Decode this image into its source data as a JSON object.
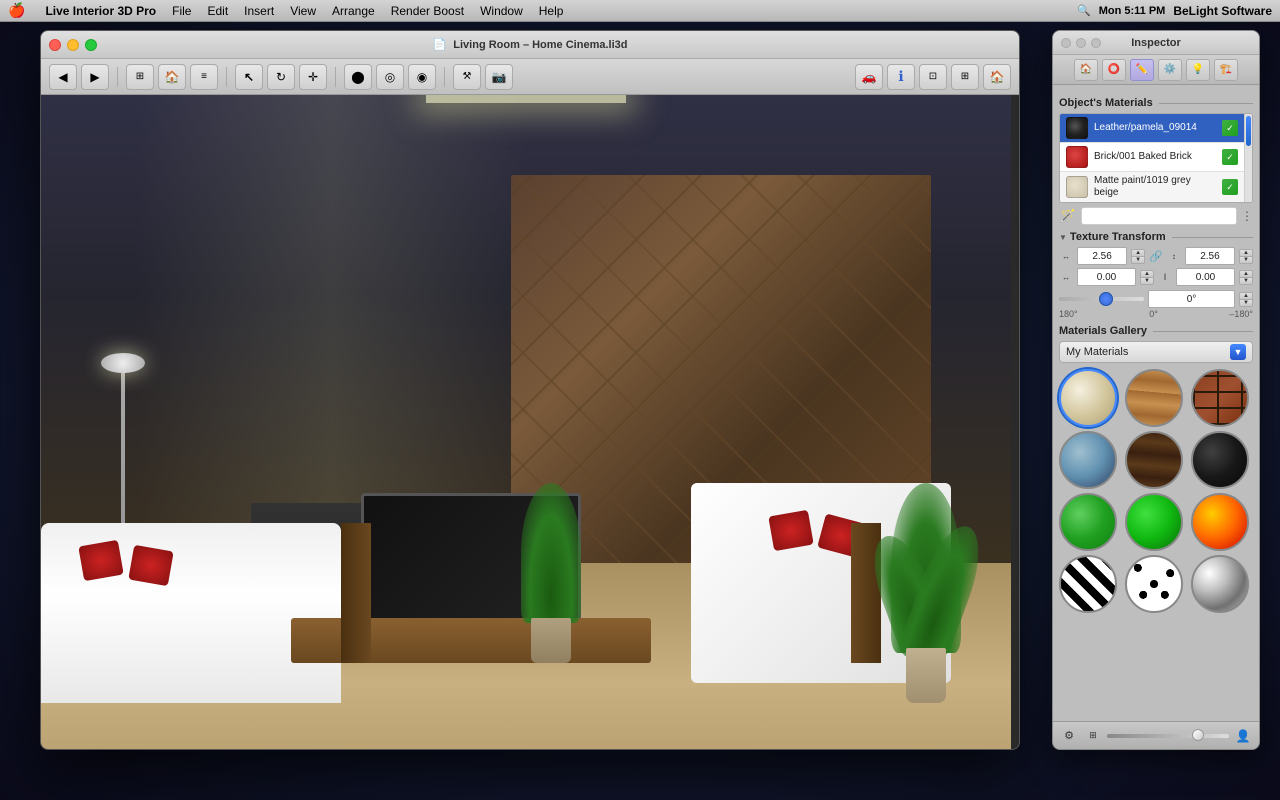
{
  "menubar": {
    "apple": "🍎",
    "items": [
      "Live Interior 3D Pro",
      "File",
      "Edit",
      "Insert",
      "View",
      "Arrange",
      "Render Boost",
      "Window",
      "Help"
    ],
    "right": {
      "clock": "Mon 5:11 PM",
      "brand": "BeLight Software"
    }
  },
  "main_window": {
    "title": "Living Room – Home Cinema.li3d",
    "traffic_lights": [
      "close",
      "minimize",
      "maximize"
    ]
  },
  "inspector": {
    "title": "Inspector",
    "tabs": [
      {
        "icon": "🏠",
        "label": "home"
      },
      {
        "icon": "⭕",
        "label": "sphere"
      },
      {
        "icon": "✏️",
        "label": "edit"
      },
      {
        "icon": "⚙️",
        "label": "texture"
      },
      {
        "icon": "💡",
        "label": "light"
      },
      {
        "icon": "🏗️",
        "label": "structure"
      }
    ],
    "objects_materials_label": "Object's Materials",
    "materials": [
      {
        "name": "Leather/pamela_09014",
        "swatch_type": "dark-gray"
      },
      {
        "name": "Brick/001 Baked Brick",
        "swatch_type": "red"
      },
      {
        "name": "Matte paint/1019 grey beige",
        "swatch_type": "cream"
      }
    ],
    "texture_transform": {
      "label": "Texture Transform",
      "scale_x": "2.56",
      "scale_y": "2.56",
      "offset_x": "0.00",
      "offset_y": "0.00",
      "rotation_value": "0°",
      "rotation_min": "180°",
      "rotation_mid": "0°",
      "rotation_max": "–180°"
    },
    "gallery": {
      "label": "Materials Gallery",
      "dropdown_value": "My Materials",
      "materials": [
        {
          "id": "cream",
          "type": "cream",
          "selected": true
        },
        {
          "id": "wood-light",
          "type": "wood-light"
        },
        {
          "id": "brick",
          "type": "brick"
        },
        {
          "id": "water",
          "type": "water"
        },
        {
          "id": "wood-dark",
          "type": "wood-dark"
        },
        {
          "id": "black",
          "type": "black"
        },
        {
          "id": "green1",
          "type": "green"
        },
        {
          "id": "green2",
          "type": "green2"
        },
        {
          "id": "fire",
          "type": "fire"
        },
        {
          "id": "zebra",
          "type": "zebra"
        },
        {
          "id": "spots",
          "type": "spots"
        },
        {
          "id": "chrome",
          "type": "chrome"
        }
      ]
    }
  }
}
